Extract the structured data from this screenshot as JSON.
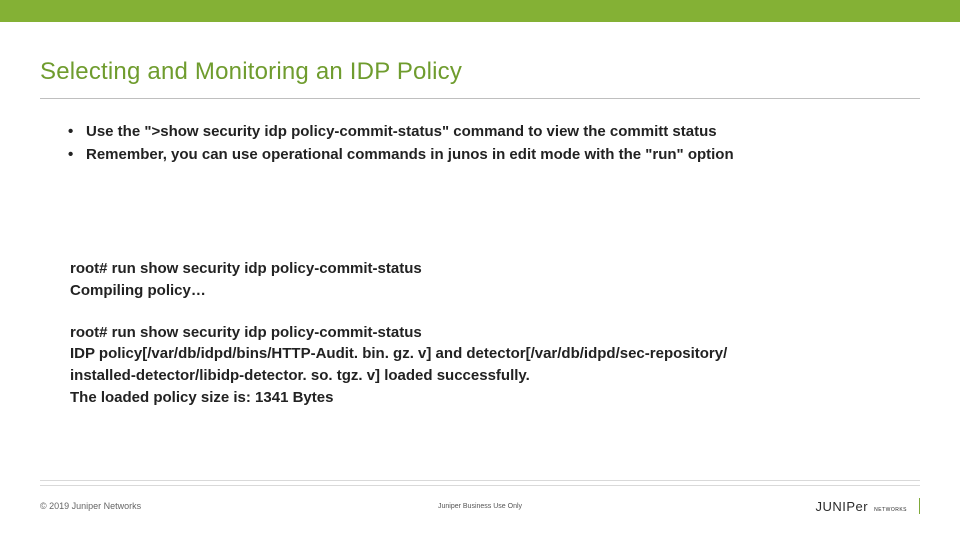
{
  "title": "Selecting and Monitoring an IDP Policy",
  "bullets": [
    "Use the \">show security idp policy-commit-status\" command to view the committ status",
    "Remember, you can use operational commands in junos in edit mode with the \"run\" option"
  ],
  "terminal": {
    "block1_line1": "root# run show security idp policy-commit-status",
    "block1_line2": " Compiling policy…",
    "block2_line1": "root# run show security idp policy-commit-status",
    "block2_line2": " IDP policy[/var/db/idpd/bins/HTTP-Audit. bin. gz. v] and detector[/var/db/idpd/sec-repository/",
    "block2_line3": "installed-detector/libidp-detector. so. tgz. v] loaded successfully.",
    "block2_line4": " The loaded policy size is: 1341 Bytes"
  },
  "footer": {
    "copyright": "© 2019 Juniper Networks",
    "center": "Juniper Business Use Only",
    "logo_text": "JUNIPer",
    "logo_sub": "NETWORKS"
  }
}
